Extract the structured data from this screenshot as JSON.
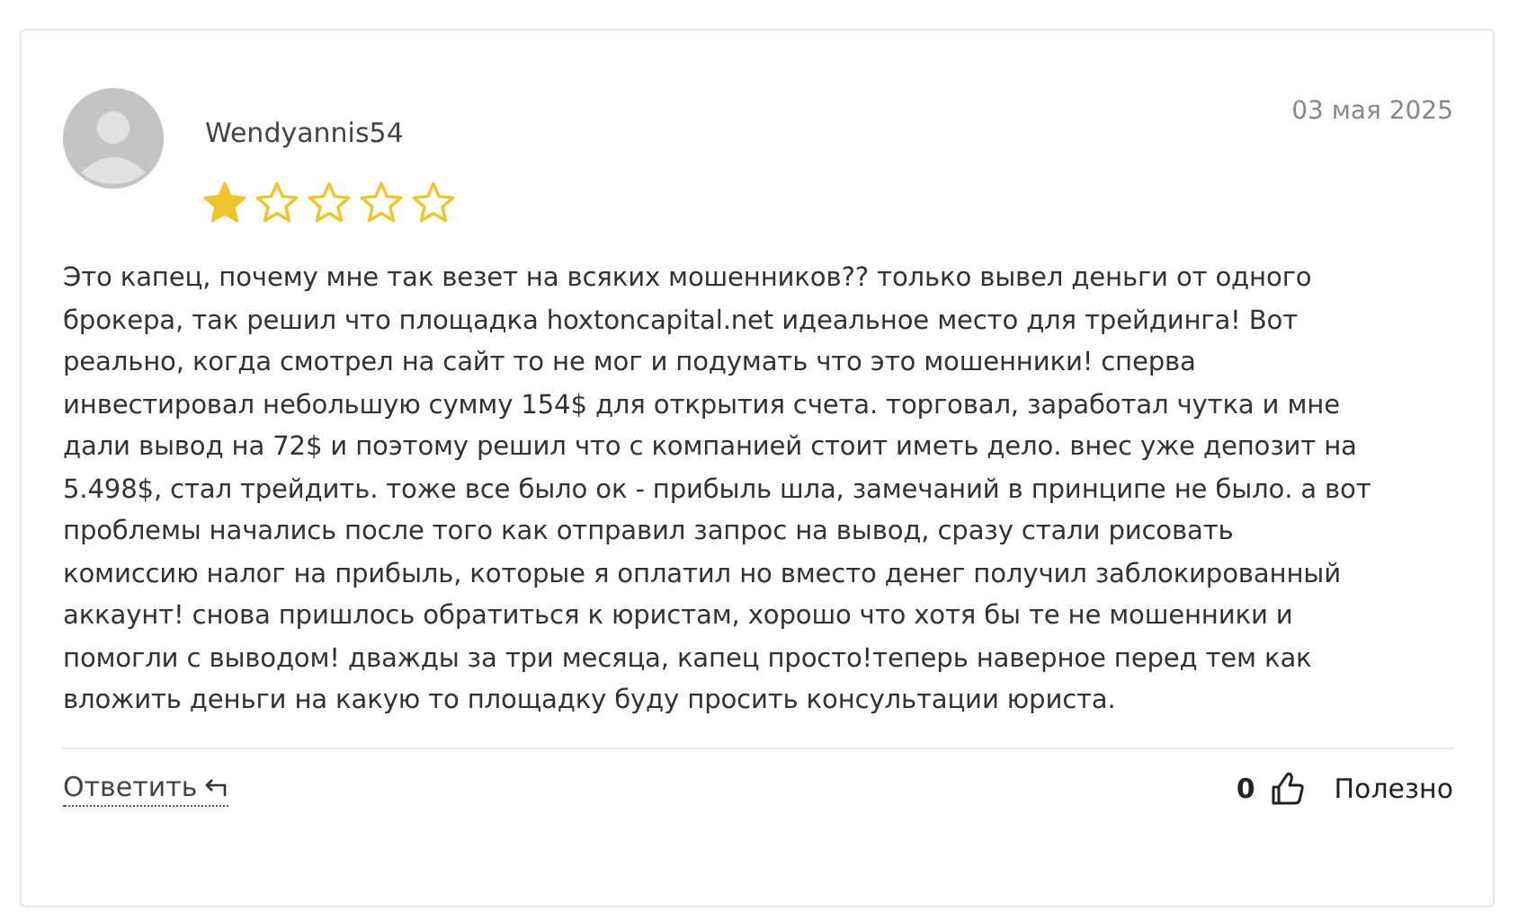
{
  "review": {
    "author": "Wendyannis54",
    "date": "03 мая 2025",
    "stars": 1,
    "text_lines": [
      "Это капец, почему мне так везет на всяких мошенников?? только вывел деньги от одного",
      "брокера, так решил что площадка hoxtoncapital.net идеальное место для трейдинга! Вот",
      "реально, когда смотрел на сайт то не мог и подумать что это мошенники! сперва",
      "инвестировал небольшую сумму 154$ для открытия счета. торговал, заработал чутка и мне",
      "дали вывод на 72$ и поэтому решил что с компанией стоит иметь дело. внес уже депозит на",
      "5.498$, стал трейдить. тоже все было ок - прибыль шла, замечаний в принципе не было. а вот",
      "проблемы начались после того как отправил запрос на вывод, сразу стали рисовать",
      "комиссию налог на прибыль, которые я оплатил но вместо денег получил заблокированный",
      "аккаунт! снова пришлось обратиться к юристам, хорошо что хотя бы те не мошенники и",
      "помогли с выводом! дважды за три месяца, капец просто!теперь наверное перед тем как",
      "вложить деньги на какую то площадку буду просить консультации юриста."
    ],
    "reply_label": "Ответить",
    "likes": "0",
    "helpful_label": "Полезно"
  }
}
